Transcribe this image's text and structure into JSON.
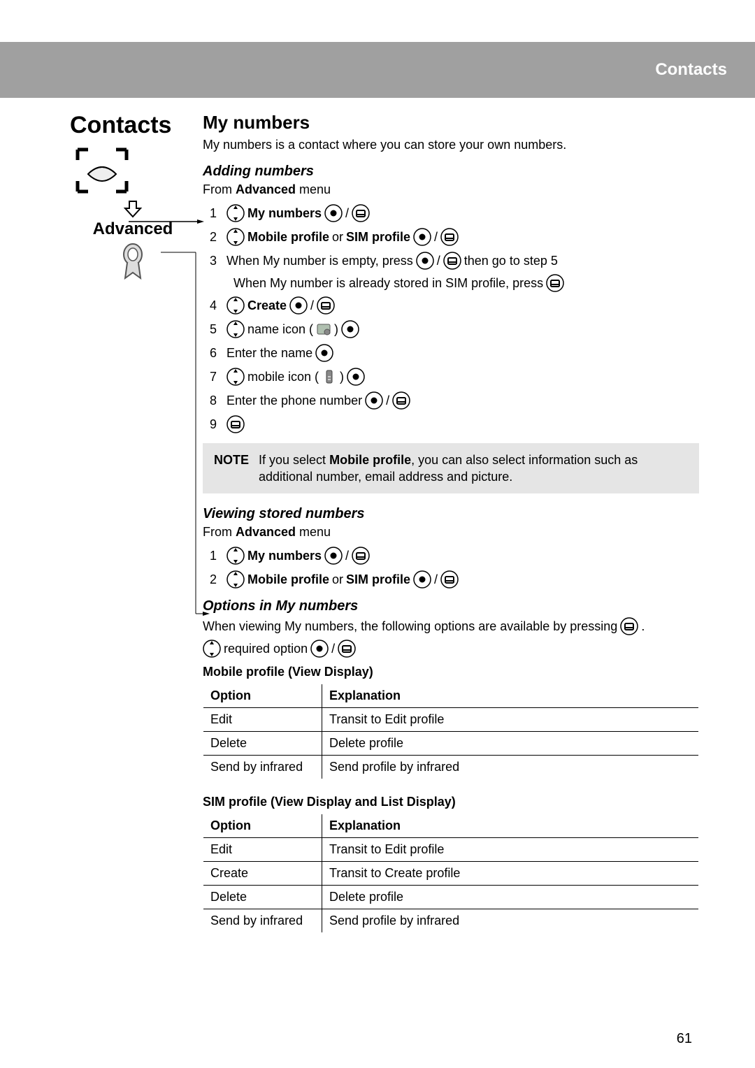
{
  "header": {
    "title": "Contacts"
  },
  "left": {
    "title": "Contacts",
    "advanced": "Advanced"
  },
  "main": {
    "title": "My numbers",
    "intro": "My numbers is a contact where you can store your own numbers.",
    "adding": {
      "heading": "Adding numbers",
      "from_pre": "From ",
      "from_bold": "Advanced",
      "from_post": " menu",
      "steps": {
        "s1": {
          "num": "1",
          "b1": "My numbers",
          "slash": " / "
        },
        "s2": {
          "num": "2",
          "b1": "Mobile profile",
          "or": " or ",
          "b2": "SIM profile",
          "slash": " / "
        },
        "s3": {
          "num": "3",
          "t1": "When My number is empty, press ",
          "slash": " / ",
          "t2": " then go to step 5",
          "sub": "When My number is already stored in SIM profile, press "
        },
        "s4": {
          "num": "4",
          "b1": "Create",
          "slash": " / "
        },
        "s5": {
          "num": "5",
          "t1": " name icon (",
          "close": ") "
        },
        "s6": {
          "num": "6",
          "t1": "Enter the name "
        },
        "s7": {
          "num": "7",
          "t1": " mobile icon ( ",
          "close": " ) "
        },
        "s8": {
          "num": "8",
          "t1": "Enter the phone number ",
          "slash": " / "
        },
        "s9": {
          "num": "9"
        }
      },
      "note_label": "NOTE",
      "note_pre": "If you select ",
      "note_bold": "Mobile profile",
      "note_post": ", you can also select information such as additional number, email address and picture."
    },
    "viewing": {
      "heading": "Viewing stored numbers",
      "from_pre": "From ",
      "from_bold": "Advanced",
      "from_post": " menu",
      "steps": {
        "s1": {
          "num": "1",
          "b1": "My numbers",
          "slash": " / "
        },
        "s2": {
          "num": "2",
          "b1": "Mobile profile",
          "or": " or ",
          "b2": "SIM profile",
          "slash": " / "
        }
      }
    },
    "options": {
      "heading": "Options in My numbers",
      "intro": "When viewing My numbers, the following options are available by pressing ",
      "line2_pre": " required option ",
      "slash": " / ",
      "dot": ".",
      "tbl1_title": "Mobile profile (View Display)",
      "tbl1": {
        "headers": [
          "Option",
          "Explanation"
        ],
        "rows": [
          [
            "Edit",
            "Transit to Edit profile"
          ],
          [
            "Delete",
            "Delete profile"
          ],
          [
            "Send by infrared",
            "Send profile by infrared"
          ]
        ]
      },
      "tbl2_title": "SIM profile (View Display and List Display)",
      "tbl2": {
        "headers": [
          "Option",
          "Explanation"
        ],
        "rows": [
          [
            "Edit",
            "Transit to Edit profile"
          ],
          [
            "Create",
            "Transit to Create profile"
          ],
          [
            "Delete",
            "Delete profile"
          ],
          [
            "Send by infrared",
            "Send profile by infrared"
          ]
        ]
      }
    }
  },
  "page_number": "61"
}
